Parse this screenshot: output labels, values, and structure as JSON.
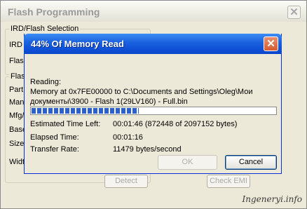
{
  "background_window": {
    "title": "Flash Programming",
    "group1_label": "IRD/Flash Selection",
    "ird_label": "IRD",
    "flash_label": "Flash",
    "group2_label": "Flas",
    "part_label": "Part",
    "manu_label": "Manu",
    "mfg_label": "Mfg/",
    "base_label": "Base",
    "size_label": "Size",
    "width_label": "Widt",
    "detect_button": "Detect",
    "check_emi_button": "Check EMI",
    "close_glyph": "✕"
  },
  "dialog": {
    "title": "44% Of Memory Read",
    "close_glyph": "✕",
    "reading_label": "Reading:",
    "memory_line1": "Memory at 0x7FE00000 to C:\\Documents and Settings\\Oleg\\Мои",
    "memory_line2": "документы\\3900 - Flash 1(29LV160) - Full.bin",
    "progress_percent": 44,
    "estimated_label": "Estimated Time Left:",
    "estimated_value": "00:01:46 (872448 of 2097152 bytes)",
    "elapsed_label": "Elapsed Time:",
    "elapsed_value": "00:01:16",
    "transfer_label": "Transfer Rate:",
    "transfer_value": "11479 bytes/second",
    "ok_label": "OK",
    "cancel_label": "Cancel"
  },
  "watermark": "Ingeneryi.info",
  "colors": {
    "title_bar_blue": "#0e4fd6",
    "progress_blue": "#2d5fd1",
    "window_face": "#ece9d8",
    "close_red": "#d65b31"
  }
}
